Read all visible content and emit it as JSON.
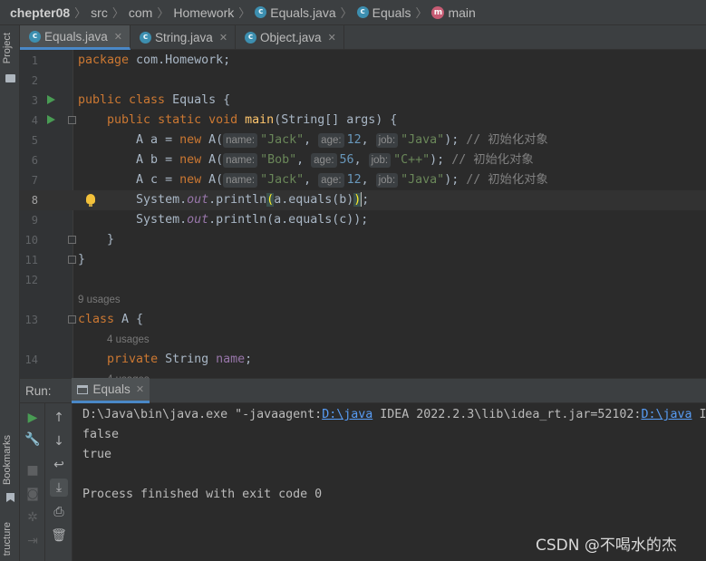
{
  "breadcrumb": {
    "project": "chepter08",
    "items": [
      "src",
      "com",
      "Homework",
      "Equals.java",
      "Equals",
      "main"
    ]
  },
  "side_labels": {
    "project": "Project",
    "bookmarks": "Bookmarks",
    "structure": "tructure"
  },
  "tabs": [
    {
      "label": "Equals.java",
      "active": true
    },
    {
      "label": "String.java",
      "active": false
    },
    {
      "label": "Object.java",
      "active": false
    }
  ],
  "editor": {
    "line_numbers": [
      "1",
      "2",
      "3",
      "4",
      "5",
      "6",
      "7",
      "8",
      "9",
      "10",
      "11",
      "12",
      "13",
      "14"
    ],
    "usages_a": "9 usages",
    "usages_name": "4 usages",
    "usages_cut": "4 usages",
    "comment": "// 初始化对象"
  },
  "run": {
    "label": "Run:",
    "tab": "Equals",
    "console": {
      "line1_pre": "D:\\Java\\bin\\java.exe \"-javaagent:",
      "link": "D:\\java",
      "line1_mid": " IDEA 2022.2.3\\lib\\idea_rt.jar=52102:",
      "line1_post": " I",
      "line2": "false",
      "line3": "true",
      "line5": "Process finished with exit code 0"
    }
  },
  "watermark": "CSDN @不喝水的杰",
  "colors": {
    "accent": "#4a88c7",
    "keyword": "#cc7832",
    "string": "#6a8759",
    "number": "#6897bb",
    "run_green": "#499c54"
  }
}
